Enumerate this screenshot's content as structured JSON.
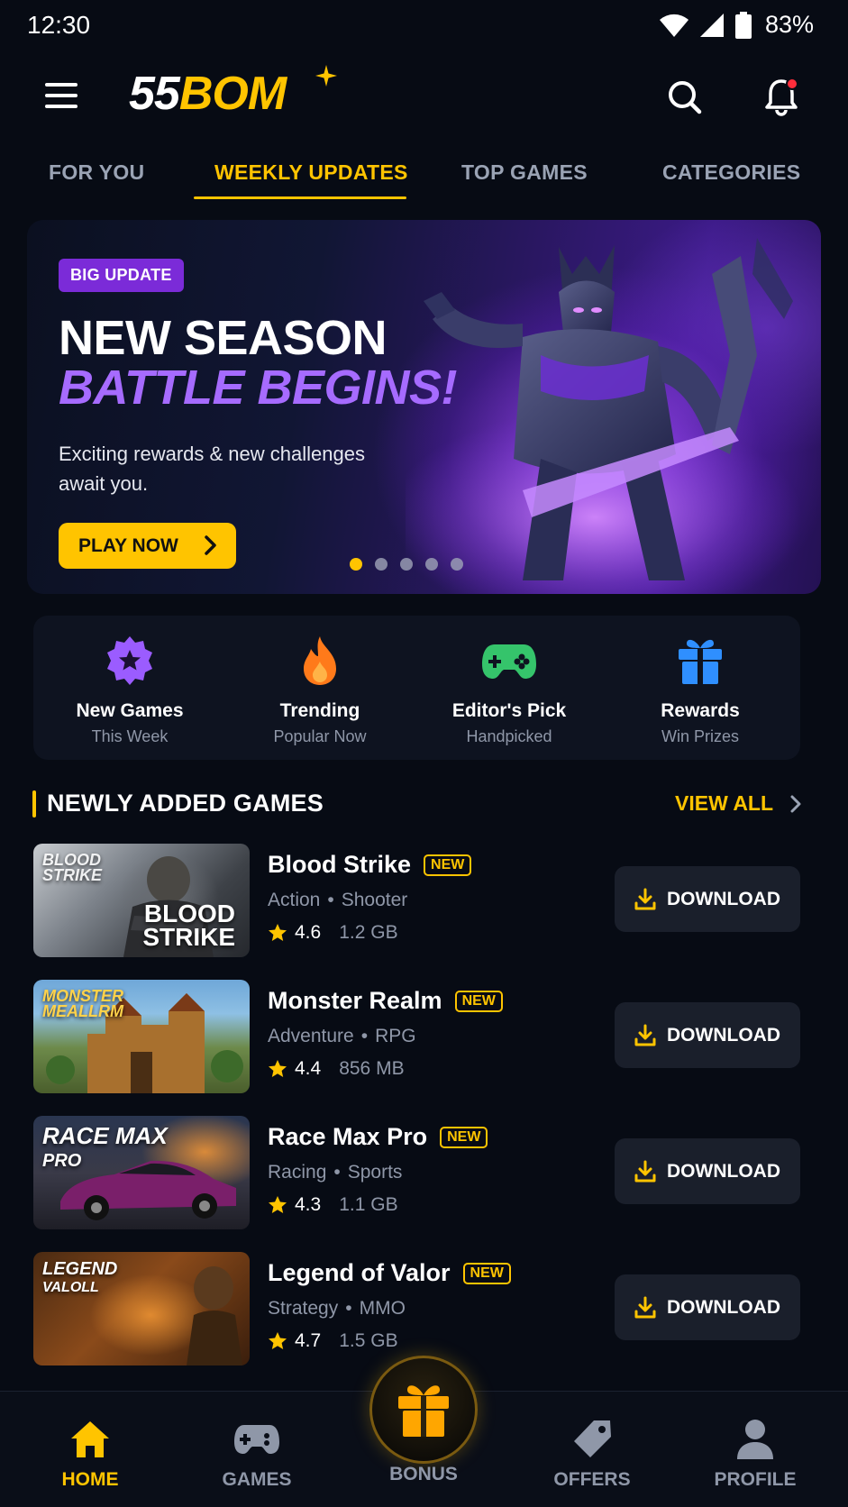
{
  "status": {
    "time": "12:30",
    "battery": "83%"
  },
  "header": {
    "logo_part1": "55",
    "logo_part2": "BOM"
  },
  "tabs": [
    {
      "label": "FOR YOU"
    },
    {
      "label": "WEEKLY UPDATES",
      "active": true
    },
    {
      "label": "TOP GAMES"
    },
    {
      "label": "CATEGORIES"
    }
  ],
  "hero": {
    "badge": "BIG UPDATE",
    "title_line1": "NEW SEASON",
    "title_line2": "BATTLE BEGINS!",
    "description": "Exciting rewards & new challenges await you.",
    "cta": "PLAY NOW"
  },
  "quick": [
    {
      "title": "New Games",
      "subtitle": "This Week",
      "icon": "star-badge-icon",
      "color": "#9b5cff"
    },
    {
      "title": "Trending",
      "subtitle": "Popular Now",
      "icon": "fire-icon",
      "color": "#ff7a1a"
    },
    {
      "title": "Editor's Pick",
      "subtitle": "Handpicked",
      "icon": "gamepad-icon",
      "color": "#35c46b"
    },
    {
      "title": "Rewards",
      "subtitle": "Win Prizes",
      "icon": "gift-icon",
      "color": "#2f8fff"
    }
  ],
  "section": {
    "title": "NEWLY ADDED GAMES",
    "view_all": "VIEW ALL"
  },
  "games": [
    {
      "name": "Blood Strike",
      "badge": "NEW",
      "genre1": "Action",
      "genre2": "Shooter",
      "rating": "4.6",
      "size": "1.2 GB",
      "thumb_text": "BLOOD STRIKE",
      "download": "DOWNLOAD"
    },
    {
      "name": "Monster Realm",
      "badge": "NEW",
      "genre1": "Adventure",
      "genre2": "RPG",
      "rating": "4.4",
      "size": "856 MB",
      "thumb_text": "MONSTER MEALLRM",
      "download": "DOWNLOAD"
    },
    {
      "name": "Race Max Pro",
      "badge": "NEW",
      "genre1": "Racing",
      "genre2": "Sports",
      "rating": "4.3",
      "size": "1.1 GB",
      "thumb_text": "RACE MAX PRO",
      "download": "DOWNLOAD"
    },
    {
      "name": "Legend of Valor",
      "badge": "NEW",
      "genre1": "Strategy",
      "genre2": "MMO",
      "rating": "4.7",
      "size": "1.5 GB",
      "thumb_text": "LEGEND VALOLL",
      "download": "DOWNLOAD"
    }
  ],
  "nav": [
    {
      "label": "HOME",
      "active": true
    },
    {
      "label": "GAMES"
    },
    {
      "label": "BONUS"
    },
    {
      "label": "OFFERS"
    },
    {
      "label": "PROFILE"
    }
  ],
  "colors": {
    "accent": "#ffc400",
    "purple": "#a66bff",
    "background": "#070b14"
  }
}
